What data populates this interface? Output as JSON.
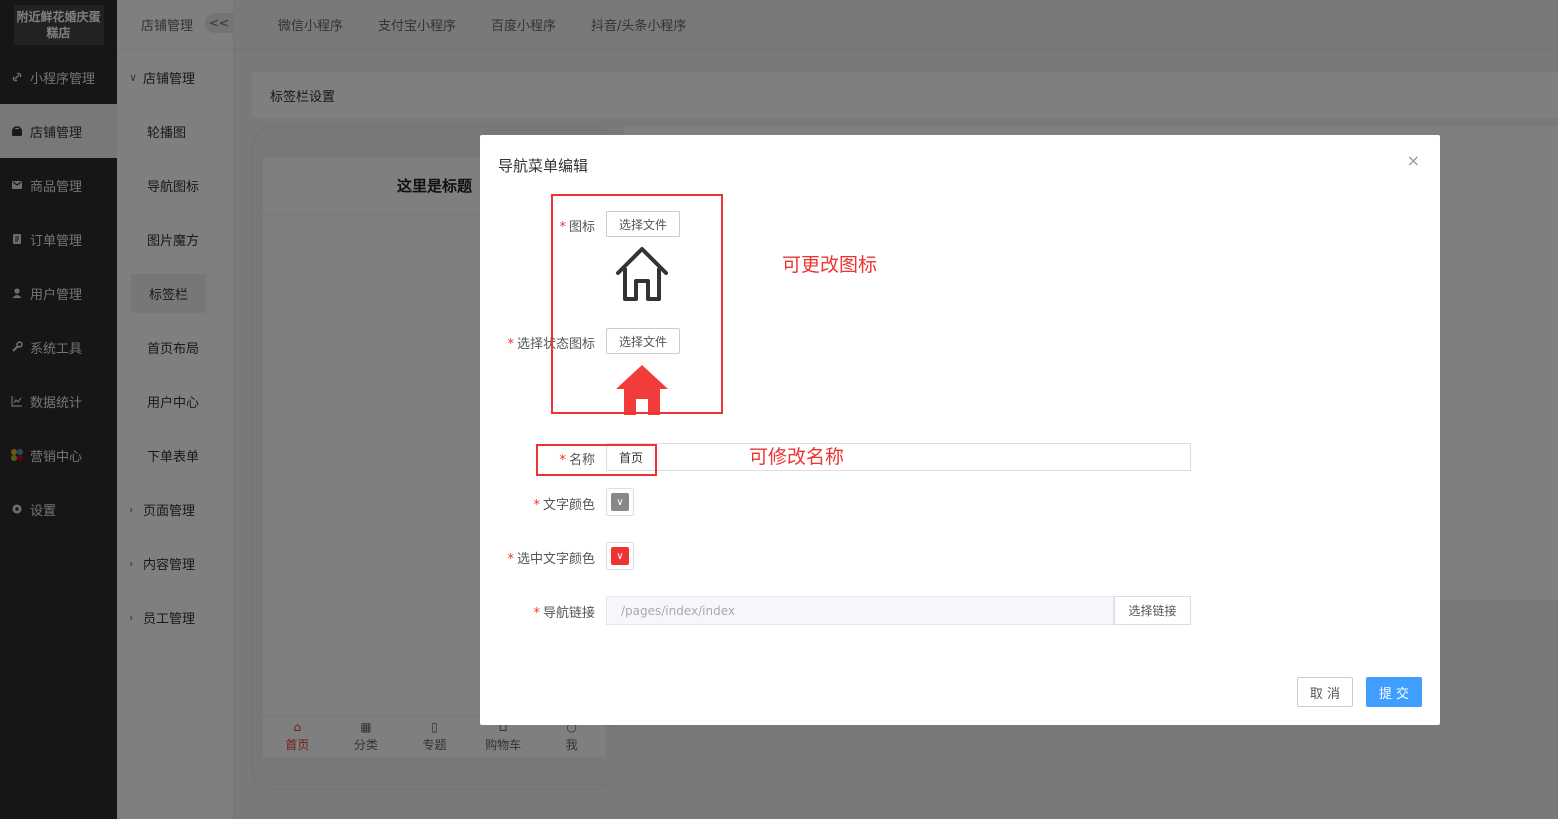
{
  "sidebar": {
    "brand": "附近鲜花婚庆蛋糕店",
    "items": [
      {
        "label": "小程序管理",
        "icon": "link-icon"
      },
      {
        "label": "店铺管理",
        "icon": "store-icon"
      },
      {
        "label": "商品管理",
        "icon": "goods-icon"
      },
      {
        "label": "订单管理",
        "icon": "order-icon"
      },
      {
        "label": "用户管理",
        "icon": "user-icon"
      },
      {
        "label": "系统工具",
        "icon": "wrench-icon"
      },
      {
        "label": "数据统计",
        "icon": "chart-icon"
      },
      {
        "label": "营销中心",
        "icon": "marketing-icon"
      },
      {
        "label": "设置",
        "icon": "settings-icon"
      }
    ]
  },
  "subnav": {
    "header": "店铺管理",
    "collapse": "<<",
    "group_open": "店铺管理",
    "items": [
      "轮播图",
      "导航图标",
      "图片魔方",
      "标签栏",
      "首页布局",
      "用户中心",
      "下单表单"
    ],
    "groups_closed": [
      "页面管理",
      "内容管理",
      "员工管理"
    ]
  },
  "topbar": {
    "tabs": [
      "微信小程序",
      "支付宝小程序",
      "百度小程序",
      "抖音/头条小程序"
    ]
  },
  "main": {
    "panel_title": "标签栏设置",
    "phone_title": "这里是标题",
    "tabbar": [
      "首页",
      "分类",
      "专题",
      "购物车",
      "我"
    ]
  },
  "modal": {
    "title": "导航菜单编辑",
    "close": "×",
    "icon_label": "图标",
    "selected_icon_label": "选择状态图标",
    "choose_file": "选择文件",
    "name_label": "名称",
    "name_value": "首页",
    "text_color_label": "文字颜色",
    "selected_text_color_label": "选中文字颜色",
    "link_label": "导航链接",
    "link_value": "/pages/index/index",
    "choose_link": "选择链接",
    "cancel": "取 消",
    "submit": "提 交",
    "text_color": "#888888",
    "selected_text_color": "#ee3333",
    "required_mark": "*"
  },
  "annotations": {
    "change_icon": "可更改图标",
    "change_name": "可修改名称"
  },
  "colors": {
    "accent": "#409eff",
    "annotation": "#ee3333",
    "sidebar_bg": "#2c2c2c"
  }
}
